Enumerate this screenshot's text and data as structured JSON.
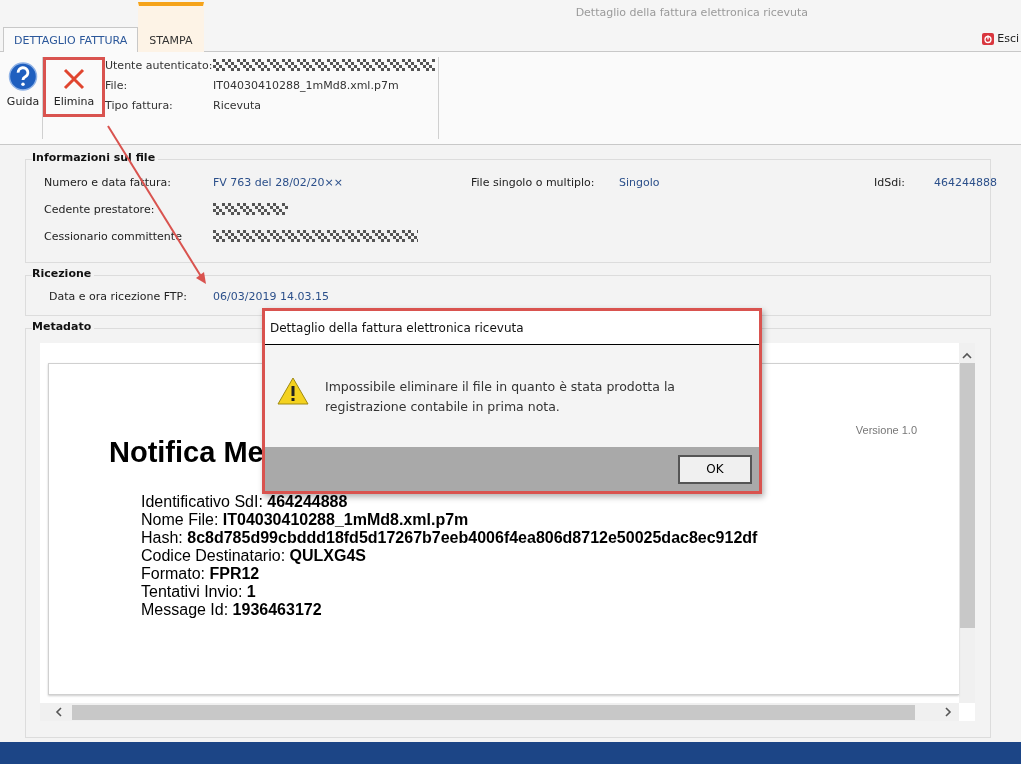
{
  "window": {
    "title": "Dettaglio della fattura elettronica ricevuta"
  },
  "tabs": [
    {
      "label": "DETTAGLIO FATTURA",
      "selected": true,
      "contextual": false
    },
    {
      "label": "STAMPA",
      "selected": false,
      "contextual": true
    }
  ],
  "exit_button": {
    "label": "Esci"
  },
  "ribbon": {
    "buttons": [
      {
        "label": "Guida",
        "kind": "help",
        "highlighted": false
      },
      {
        "label": "Elimina",
        "kind": "delete",
        "highlighted": true
      }
    ],
    "info": [
      {
        "label": "Utente autenticato:",
        "kind": "redacted"
      },
      {
        "label": "File:",
        "kind": "text",
        "value": "IT04030410288_1mMd8.xml.p7m"
      },
      {
        "label": "Tipo fattura:",
        "kind": "text",
        "value": "Ricevuta"
      }
    ]
  },
  "file_info": {
    "title": "Informazioni sul file",
    "fields": [
      {
        "label": "Numero e data fattura:",
        "kind": "text",
        "value": "FV 763 del 28/02/20××"
      },
      {
        "label": "File singolo o multiplo:",
        "kind": "text",
        "value": "Singolo"
      },
      {
        "label": "IdSdi:",
        "kind": "text",
        "value": "464244888"
      },
      {
        "label": "Cedente prestatore:",
        "kind": "redacted"
      },
      {
        "label": "Cessionario committente",
        "kind": "redacted"
      }
    ]
  },
  "reception": {
    "title": "Ricezione",
    "fields": [
      {
        "label": "Data e ora ricezione FTP:",
        "kind": "text",
        "value": "06/03/2019 14.03.15"
      }
    ]
  },
  "metadata": {
    "title": "Metadato",
    "document": {
      "version": "Versione 1.0",
      "heading": "Notifica Me",
      "lines": [
        "Identificativo SdI: **464244888**",
        "Nome File: **IT04030410288_1mMd8.xml.p7m**",
        "Hash: **8c8d785d99cbddd18fd5d17267b7eeb4006f4ea806d8712e50025dac8ec912df**",
        "Codice Destinatario: **QULXG4S**",
        "Formato: **FPR12**",
        "Tentativi Invio: **1**",
        "Message Id: **1936463172**"
      ]
    }
  },
  "dialog": {
    "title": "Dettaglio della fattura elettronica ricevuta",
    "highlighted": true,
    "message": "Impossibile eliminare il file in quanto è stata prodotta la registrazione contabile in prima nota.",
    "buttons": [
      "OK"
    ]
  }
}
